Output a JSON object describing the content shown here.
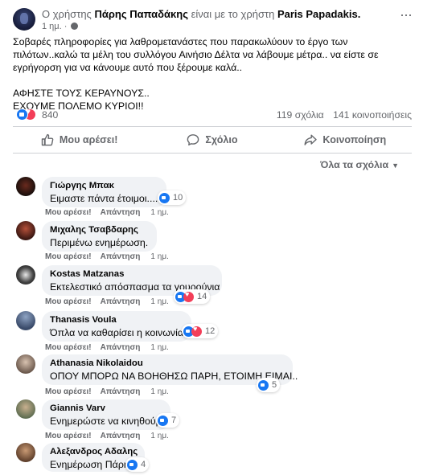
{
  "post": {
    "title_prefix": "Ο χρήστης",
    "author": "Πάρης Παπαδάκης",
    "title_middle": "είναι με το χρήστη",
    "tagged": "Paris Papadakis.",
    "time": "1 ημ. ·",
    "more_icon": "more-dots-icon",
    "body_line1": "Σοβαρές πληροφορίες για λαθρομετανάστες που παρακωλύουν το έργο των πιλότων..καλώ τα μέλη του συλλόγου Αινήσιο Δέλτα να λάβουμε μέτρα.. να είστε σε εγρήγορση για να κάνουμε αυτό που ξέρουμε καλά..",
    "body_line2": "ΑΦΗΣΤΕ ΤΟΥΣ ΚΕΡΑΥΝΟΥΣ..",
    "body_line3": "ΕΧΟΥΜΕ ΠΟΛΕΜΟ ΚΥΡΙΟΙ!!"
  },
  "stats": {
    "reactions": "840",
    "comments": "119 σχόλια",
    "shares": "141 κοινοποιήσεις"
  },
  "actions": {
    "like": "Μου αρέσει!",
    "comment": "Σχόλιο",
    "share": "Κοινοποίηση"
  },
  "sort": {
    "label": "Όλα τα σχόλια"
  },
  "comment_actions": {
    "like": "Μου αρέσει!",
    "reply": "Απάντηση",
    "time": "1 ημ."
  },
  "comments": [
    {
      "name": "Γιώργης Μπακ",
      "text": "Ειμαστε πάντα έτοιμοι....",
      "reactions": "10",
      "love": false
    },
    {
      "name": "Μιχαλης Τσαβδαρης",
      "text": "Περιμένω ενημέρωση.",
      "reactions": "",
      "love": false
    },
    {
      "name": "Kostas Matzanas",
      "text": "Εκτελεστικό απόσπασμα τα γουρούνια",
      "reactions": "14",
      "love": true
    },
    {
      "name": "Thanasis Voula",
      "text": "Όπλα να καθαρίσει η κοινωνία ....",
      "reactions": "12",
      "love": true
    },
    {
      "name": "Athanasia Nikolaidou",
      "text": "ΟΠΟΥ ΜΠΟΡΩ ΝΑ ΒΟΗΘΗΣΩ ΠΑΡΗ, ΕΤΟΙΜΗ ΕΙΜΑΙ..",
      "reactions": "5",
      "love": false
    },
    {
      "name": "Giannis Varv",
      "text": "Ενημερώστε να κινηθούμε",
      "reactions": "7",
      "love": false
    },
    {
      "name": "Αλεξανδρος Αδαλης",
      "text": "Ενημέρωση Πάρη",
      "reactions": "4",
      "love": false
    }
  ],
  "colors": {
    "accent": "#1877f2",
    "love": "#f33e58",
    "bubble": "#f0f2f5",
    "muted": "#65676b"
  }
}
